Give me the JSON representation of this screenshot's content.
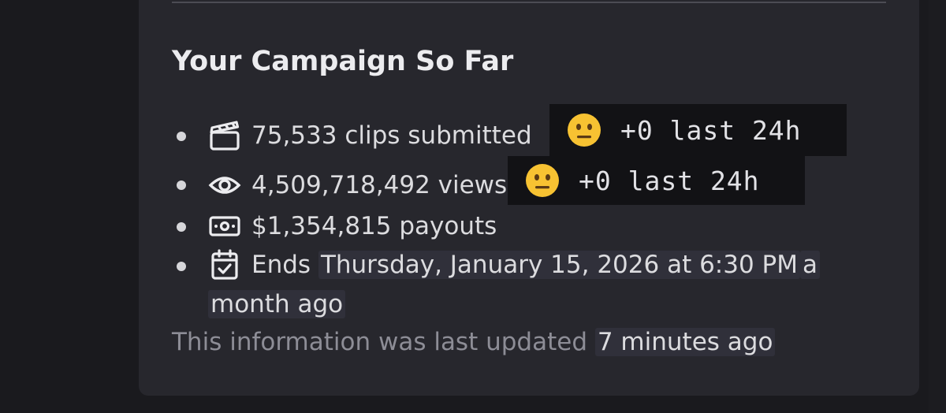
{
  "embed": {
    "title": "Your Campaign So Far",
    "stats": [
      {
        "icon": "clapperboard-icon",
        "text": "75,533 clips submitted",
        "delta_emoji": "neutral-face-emoji",
        "delta": "+0 last 24h"
      },
      {
        "icon": "eye-icon",
        "text": "4,509,718,492 views",
        "delta_emoji": "neutral-face-emoji",
        "delta": "+0 last 24h"
      },
      {
        "icon": "money-icon",
        "text": "$1,354,815 payouts"
      },
      {
        "icon": "calendar-check-icon",
        "prefix": "Ends",
        "date": "Thursday, January 15, 2026 at 6:30 PM",
        "relative_a": "a",
        "relative_b": "month ago"
      }
    ],
    "footer": {
      "prefix": "This information was last updated",
      "relative": "7 minutes ago"
    }
  },
  "colors": {
    "card_background": "#27272d",
    "page_background": "#1a1a1e",
    "delta_background": "#121215",
    "footer_text": "#8d8d96"
  }
}
